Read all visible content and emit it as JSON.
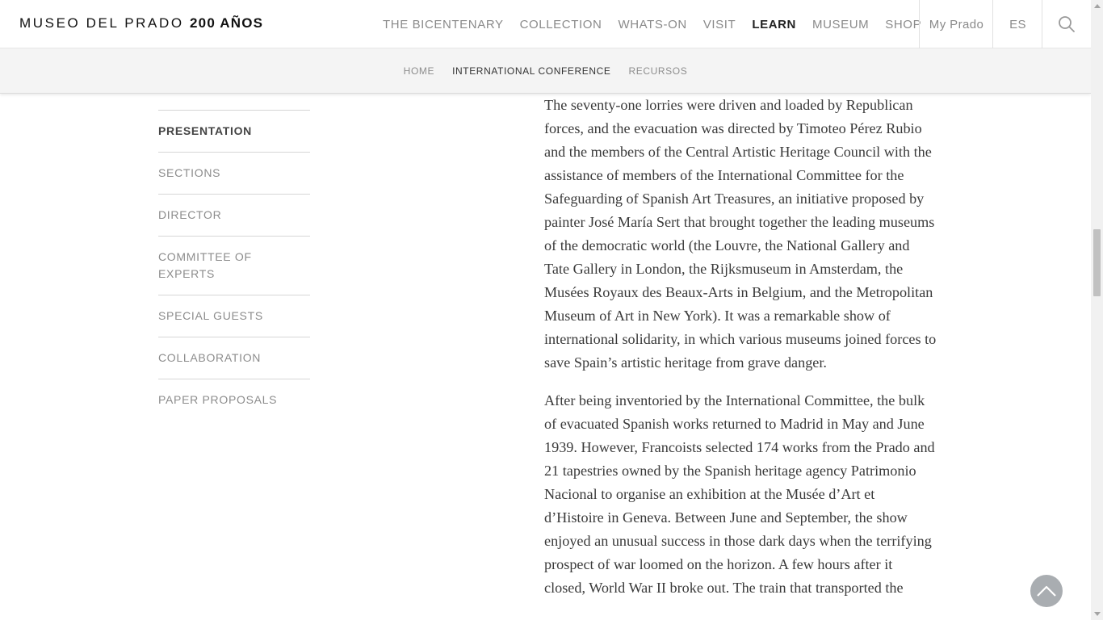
{
  "header": {
    "logo_text": "MUSEO DEL PRADO",
    "logo_bold": "200 AÑOS",
    "nav": [
      {
        "label": "THE BICENTENARY"
      },
      {
        "label": "COLLECTION"
      },
      {
        "label": "WHATS-ON"
      },
      {
        "label": "VISIT"
      },
      {
        "label": "LEARN",
        "active": true
      },
      {
        "label": "MUSEUM"
      },
      {
        "label": "SHOP"
      }
    ],
    "my_prado": "My Prado",
    "language": "ES",
    "search_icon": "search-icon"
  },
  "subnav": [
    {
      "label": "HOME"
    },
    {
      "label": "INTERNATIONAL CONFERENCE",
      "active": true
    },
    {
      "label": "RECURSOS"
    }
  ],
  "sidebar": {
    "items": [
      {
        "label": "PRESENTATION",
        "active": true
      },
      {
        "label": "SECTIONS"
      },
      {
        "label": "DIRECTOR"
      },
      {
        "label": "COMMITTEE OF EXPERTS"
      },
      {
        "label": "SPECIAL GUESTS"
      },
      {
        "label": "COLLABORATION"
      },
      {
        "label": "PAPER PROPOSALS"
      }
    ]
  },
  "article": {
    "paragraphs": [
      "The seventy-one lorries were driven and loaded by Republican forces, and the evacuation was directed by Timoteo Pérez Rubio and the members of the Central Artistic Heritage Council with the assistance of members of the International Committee for the Safeguarding of Spanish Art Treasures, an initiative proposed by painter José María Sert that brought together the leading museums of the democratic world (the Louvre, the National Gallery and Tate Gallery in London, the Rijksmuseum in Amsterdam, the Musées Royaux des Beaux-Arts in Belgium, and the Metropolitan Museum of Art in New York). It was a remarkable show of international solidarity, in which various museums joined forces to save Spain’s artistic heritage from grave danger.",
      "After being inventoried by the International Committee, the bulk of evacuated Spanish works returned to Madrid in May and June 1939. However, Francoists selected 174 works from the Prado and 21 tapestries owned by the Spanish heritage agency Patrimonio Nacional to organise an exhibition at the Musée d’Art et d’Histoire in Geneva. Between June and September, the show enjoyed an unusual success in those dark days when the terrifying prospect of war loomed on the horizon. A few hours after it closed, World War II broke out. The train that transported the"
    ]
  },
  "back_to_top_icon": "chevron-up-icon",
  "colors": {
    "nav_inactive": "#8a8a8a",
    "nav_active": "#222222",
    "subnav_bg": "#f4f4f4",
    "body_text": "#3a3a3a",
    "back_to_top_bg": "#a9adb1"
  }
}
